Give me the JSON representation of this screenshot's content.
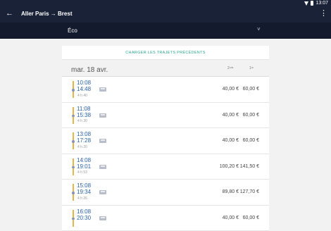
{
  "app": {
    "title": "Aller Paris → Brest",
    "back_icon": "arrow-left-icon",
    "more_icon": "more-vert-icon"
  },
  "status": {
    "wifi_icon": "wifi-icon",
    "battery_icon": "battery-icon",
    "time": "13:07"
  },
  "classbar": {
    "selected": "Éco",
    "chevron": "˅"
  },
  "load_previous": "CHARGER LES TRAJETS PRÉCÉDENTS",
  "day": {
    "date": "mar. 18 avr.",
    "col_second": "2ⁿᵈᵉ",
    "col_first": "1ʳᵉ"
  },
  "trips": [
    {
      "dep": "10:08",
      "arr": "14:48",
      "dur": "4 h 40",
      "p2": "40,00 €",
      "p1": "60,00 €"
    },
    {
      "dep": "11:08",
      "arr": "15:38",
      "dur": "4 h 30",
      "p2": "40,00 €",
      "p1": "60,00 €"
    },
    {
      "dep": "13:08",
      "arr": "17:28",
      "dur": "4 h 20",
      "p2": "40,00 €",
      "p1": "60,00 €"
    },
    {
      "dep": "14:08",
      "arr": "19:01",
      "dur": "4 h 53",
      "p2": "100,20 €",
      "p1": "141,50 €"
    },
    {
      "dep": "15:08",
      "arr": "19:34",
      "dur": "4 h 26",
      "p2": "89,80 €",
      "p1": "127,70 €"
    },
    {
      "dep": "16:08",
      "arr": "20:30",
      "dur": "",
      "p2": "40,00 €",
      "p1": "60,00 €"
    }
  ]
}
